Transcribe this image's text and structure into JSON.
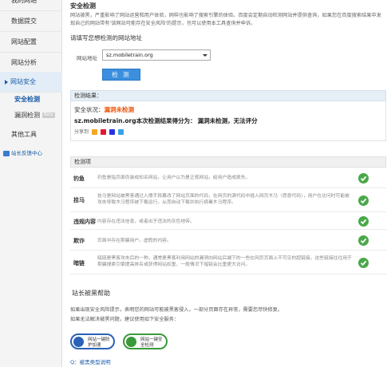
{
  "sidebar": {
    "items": [
      {
        "label": "我的网站"
      },
      {
        "label": "数据提交"
      },
      {
        "label": "网站配置"
      },
      {
        "label": "网站分析"
      },
      {
        "label": "网站安全"
      },
      {
        "label": "安全检测"
      },
      {
        "label": "漏洞检测",
        "badge": "Beta"
      },
      {
        "label": "其他工具"
      }
    ],
    "feedback": "站长反馈中心"
  },
  "main": {
    "title": "安全检测",
    "description": "网站被黑，严重影响了网站运营和用户体验，网样也影响了搜索引擎的体验。百度会定期自动检测网站并提供查询，如果您在百度搜索结果中发现自己的网站带有'该网站可能存在安全风险'的提示，也可以使用本工具查询并申诉。",
    "form_label": "请填写您想检测的网站地址",
    "url_label": "网站地址",
    "url_value": "sz.mobiletrain.org",
    "check_button": "检 测",
    "result_header": "检测结果：",
    "status_label": "安全状况：",
    "status_value": "漏洞未检测",
    "site_line": "sz.mobiletrain.org本次检测结果得分为：",
    "site_result": "漏洞未检测，无法评分",
    "share_label": "分享到"
  },
  "items_header": "检测项",
  "items": [
    {
      "name": "钓鱼",
      "desc": "钓鱼是指页面伪装成知名网站，让用户以为是正规网站，给用户造成损失。"
    },
    {
      "name": "挂马",
      "desc": "挂马是网站被黑客通过入侵手段篡改了网站页面的代码，在网页的源代码中插入网页木马（恶意代码），用户在访问时可能被攻击导致木马程序被下载运行，从而自动下载并执行病毒木马程序。"
    },
    {
      "name": "违规内容",
      "desc": "内容存在违法信息，或者出于违法的灰色地带。"
    },
    {
      "name": "欺诈",
      "desc": "页面中存在欺骗用户，虚假的内容。"
    },
    {
      "name": "暗链",
      "desc": "暗链是黑客攻击后的一种，通常是黑客利用网站的漏洞向网站后端下的一些在网页页面上不可见的超链接，这些链接往往用于欺骗搜索引擎提高排名或获得网站权重，一般情况下暗链会比重更大访问。"
    }
  ],
  "help": {
    "title": "站长被黑帮助",
    "line1": "如果出现安全风险提示，表明您的网站可能被黑客侵入，一部分页面存在异常，需要您尽快修复。",
    "line2": "如果无法解决被黑问题，建议使用如下安全服务：",
    "badge1": "网站一键防护加速",
    "badge2": "网站一键安全检测",
    "qlink": "Q：被黑类型说明"
  },
  "colors": {
    "accent": "#1a5ca8",
    "button": "#3b8fde",
    "warning": "#e8560b",
    "ok": "#4aa84a"
  }
}
